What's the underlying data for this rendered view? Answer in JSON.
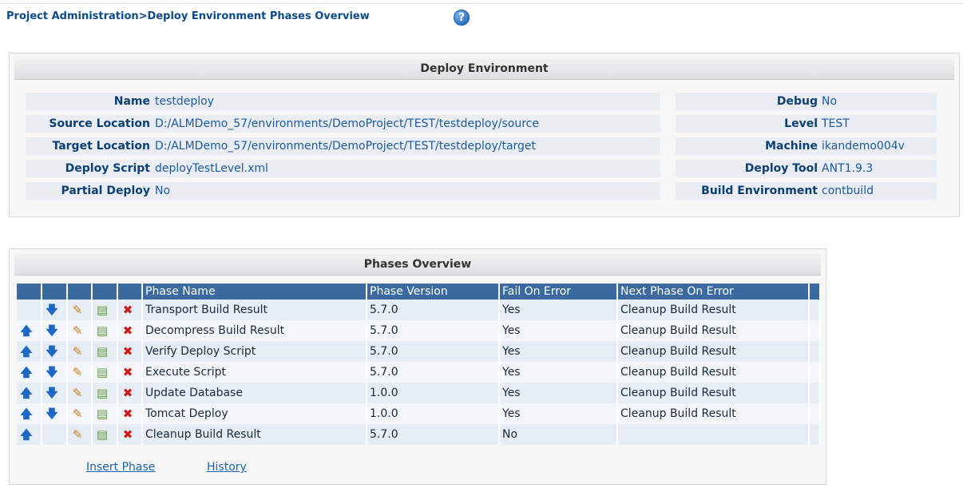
{
  "breadcrumb": "Project Administration>Deploy Environment Phases Overview",
  "help_icon": "?",
  "deploy_env": {
    "title": "Deploy Environment",
    "left": [
      {
        "label": "Name",
        "value": "testdeploy"
      },
      {
        "label": "Source Location",
        "value": "D:/ALMDemo_57/environments/DemoProject/TEST/testdeploy/source"
      },
      {
        "label": "Target Location",
        "value": "D:/ALMDemo_57/environments/DemoProject/TEST/testdeploy/target"
      },
      {
        "label": "Deploy Script",
        "value": "deployTestLevel.xml"
      },
      {
        "label": "Partial Deploy",
        "value": "No"
      }
    ],
    "right": [
      {
        "label": "Debug",
        "value": "No"
      },
      {
        "label": "Level",
        "value": "TEST"
      },
      {
        "label": "Machine",
        "value": "ikandemo004v"
      },
      {
        "label": "Deploy Tool",
        "value": "ANT1.9.3"
      },
      {
        "label": "Build Environment",
        "value": "contbuild"
      }
    ]
  },
  "phases": {
    "title": "Phases Overview",
    "columns": [
      "Phase Name",
      "Phase Version",
      "Fail On Error",
      "Next Phase On Error"
    ],
    "icons": {
      "up": "🡅",
      "down": "🡇",
      "edit": "✎",
      "copy": "▤",
      "delete": "✖"
    },
    "rows": [
      {
        "name": "Transport Build Result",
        "version": "5.7.0",
        "fail": "Yes",
        "next": "Cleanup Build Result"
      },
      {
        "name": "Decompress Build Result",
        "version": "5.7.0",
        "fail": "Yes",
        "next": "Cleanup Build Result"
      },
      {
        "name": "Verify Deploy Script",
        "version": "5.7.0",
        "fail": "Yes",
        "next": "Cleanup Build Result"
      },
      {
        "name": "Execute Script",
        "version": "5.7.0",
        "fail": "Yes",
        "next": "Cleanup Build Result"
      },
      {
        "name": "Update Database",
        "version": "1.0.0",
        "fail": "Yes",
        "next": "Cleanup Build Result"
      },
      {
        "name": "Tomcat Deploy",
        "version": "1.0.0",
        "fail": "Yes",
        "next": "Cleanup Build Result"
      },
      {
        "name": "Cleanup Build Result",
        "version": "5.7.0",
        "fail": "No",
        "next": ""
      }
    ],
    "insert_label": "Insert Phase",
    "history_label": "History"
  }
}
